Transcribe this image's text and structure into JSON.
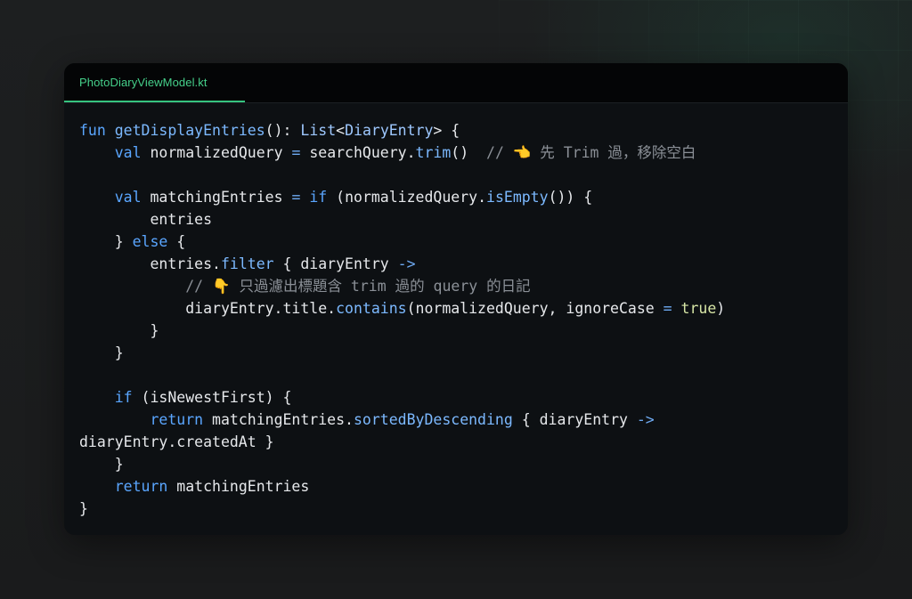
{
  "tab": {
    "filename": "PhotoDiaryViewModel.kt"
  },
  "code_lines": [
    [
      [
        "kw",
        "fun"
      ],
      [
        "pl",
        " "
      ],
      [
        "fn",
        "getDisplayEntries"
      ],
      [
        "pl",
        "(): "
      ],
      [
        "ty",
        "List"
      ],
      [
        "pl",
        "<"
      ],
      [
        "ty",
        "DiaryEntry"
      ],
      [
        "pl",
        "> {"
      ]
    ],
    [
      [
        "pl",
        "    "
      ],
      [
        "kw",
        "val"
      ],
      [
        "pl",
        " normalizedQuery "
      ],
      [
        "op",
        "="
      ],
      [
        "pl",
        " searchQuery."
      ],
      [
        "fn",
        "trim"
      ],
      [
        "pl",
        "()  "
      ],
      [
        "cm",
        "// 👈 先 Trim 過，移除空白"
      ]
    ],
    [],
    [
      [
        "pl",
        "    "
      ],
      [
        "kw",
        "val"
      ],
      [
        "pl",
        " matchingEntries "
      ],
      [
        "op",
        "="
      ],
      [
        "pl",
        " "
      ],
      [
        "kw",
        "if"
      ],
      [
        "pl",
        " (normalizedQuery."
      ],
      [
        "fn",
        "isEmpty"
      ],
      [
        "pl",
        "()) {"
      ]
    ],
    [
      [
        "pl",
        "        entries"
      ]
    ],
    [
      [
        "pl",
        "    } "
      ],
      [
        "kw",
        "else"
      ],
      [
        "pl",
        " {"
      ]
    ],
    [
      [
        "pl",
        "        entries."
      ],
      [
        "fn",
        "filter"
      ],
      [
        "pl",
        " { diaryEntry "
      ],
      [
        "op",
        "->"
      ]
    ],
    [
      [
        "pl",
        "            "
      ],
      [
        "cm",
        "// 👇 只過濾出標題含 trim 過的 query 的日記"
      ]
    ],
    [
      [
        "pl",
        "            diaryEntry.title."
      ],
      [
        "fn",
        "contains"
      ],
      [
        "pl",
        "(normalizedQuery, ignoreCase "
      ],
      [
        "op",
        "="
      ],
      [
        "pl",
        " "
      ],
      [
        "bl",
        "true"
      ],
      [
        "pl",
        ")"
      ]
    ],
    [
      [
        "pl",
        "        }"
      ]
    ],
    [
      [
        "pl",
        "    }"
      ]
    ],
    [],
    [
      [
        "pl",
        "    "
      ],
      [
        "kw",
        "if"
      ],
      [
        "pl",
        " (isNewestFirst) {"
      ]
    ],
    [
      [
        "pl",
        "        "
      ],
      [
        "kw",
        "return"
      ],
      [
        "pl",
        " matchingEntries."
      ],
      [
        "fn",
        "sortedByDescending"
      ],
      [
        "pl",
        " { diaryEntry "
      ],
      [
        "op",
        "->"
      ]
    ],
    [
      [
        "pl",
        "diaryEntry.createdAt }"
      ]
    ],
    [
      [
        "pl",
        "    }"
      ]
    ],
    [
      [
        "pl",
        "    "
      ],
      [
        "kw",
        "return"
      ],
      [
        "pl",
        " matchingEntries"
      ]
    ],
    [
      [
        "pl",
        "}"
      ]
    ]
  ],
  "colors": {
    "tab_accent": "#36c47f",
    "keyword": "#5aa6ff",
    "function": "#7cb9ff",
    "comment": "#8b9097",
    "boolean": "#d7e6a6",
    "text": "#e6e8eb",
    "editor_bg": "#0d1013"
  }
}
